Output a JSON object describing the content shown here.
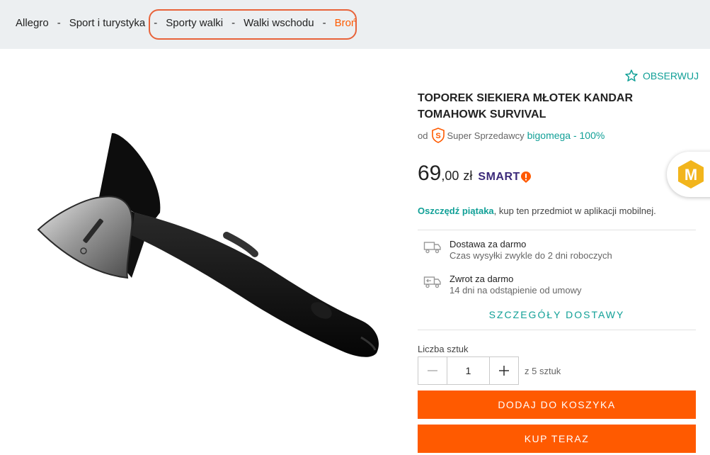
{
  "breadcrumb": {
    "items": [
      "Allegro",
      "Sport i turystyka",
      "Sporty walki",
      "Walki wschodu",
      "Broń"
    ],
    "separator": "-"
  },
  "product": {
    "observe_label": "OBSERWUJ",
    "title": "TOPOREK SIEKIERA MŁOTEK KANDAR TOMAHOWK SURVIVAL",
    "image_alt": "axe-product-photo"
  },
  "seller": {
    "prefix": "od",
    "badge_label": "Super Sprzedawcy",
    "name": "bigomega - 100%"
  },
  "price": {
    "main": "69",
    "cents": ",00",
    "currency": "zł",
    "smart_label": "SMART"
  },
  "promo": {
    "bold": "Oszczędź piątaka",
    "rest": ", kup ten przedmiot w aplikacji mobilnej."
  },
  "delivery": {
    "shipping_title": "Dostawa za darmo",
    "shipping_sub": "Czas wysyłki zwykle do 2 dni roboczych",
    "return_title": "Zwrot za darmo",
    "return_sub": "14 dni na odstąpienie od umowy",
    "details_link": "SZCZEGÓŁY DOSTAWY"
  },
  "quantity": {
    "label": "Liczba sztuk",
    "value": "1",
    "available": "z 5 sztuk"
  },
  "actions": {
    "add_to_cart": "DODAJ DO KOSZYKA",
    "buy_now": "KUP TERAZ"
  },
  "colors": {
    "accent_orange": "#ff5a00",
    "accent_teal": "#11a097",
    "breadcrumb_bg": "#eceff1",
    "highlight": "#e8633a"
  }
}
